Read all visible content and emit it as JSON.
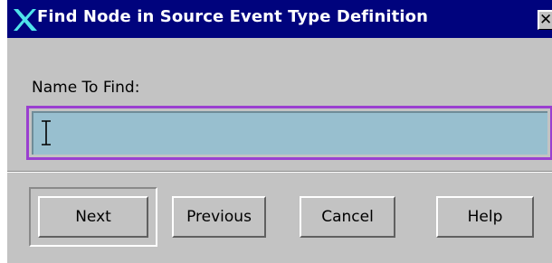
{
  "window": {
    "title": "Find Node in Source Event Type Definition",
    "close_glyph": "✕",
    "colors": {
      "titlebar": "#00037d",
      "background": "#c3c3c3",
      "input_fill": "#98bfcf",
      "focus_ring": "#9a3fd0",
      "app_icon": "#4fe3ea"
    }
  },
  "form": {
    "name_label": "Name To Find:",
    "name_value": "",
    "name_placeholder": ""
  },
  "buttons": {
    "next": "Next",
    "previous": "Previous",
    "cancel": "Cancel",
    "help": "Help"
  },
  "icons": {
    "app": "x-logo-icon",
    "close": "close-icon",
    "cursor": "text-cursor-icon"
  }
}
